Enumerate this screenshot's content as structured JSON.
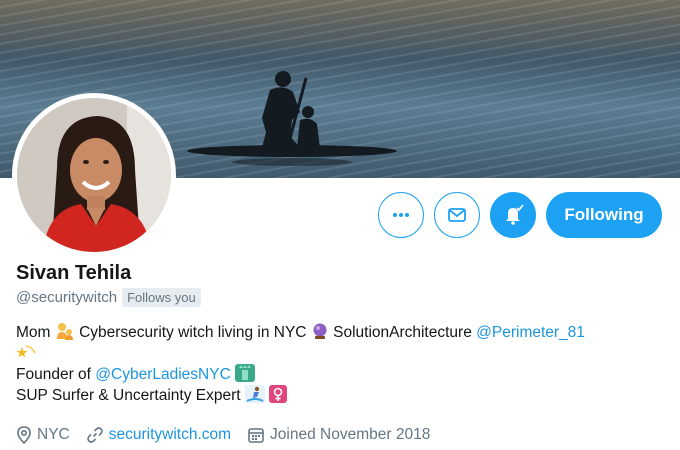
{
  "profile": {
    "name": "Sivan Tehila",
    "handle": "@securitywitch",
    "follows_you": "Follows you"
  },
  "actions": {
    "more_icon": "more-icon",
    "message_icon": "envelope-icon",
    "notify_icon": "bell-check-icon",
    "follow_label": "Following"
  },
  "bio": {
    "line1_a": "Mom",
    "line1_b": "Cybersecurity witch living in NYC",
    "line1_c": "SolutionArchitecture",
    "line1_mention": "@Perimeter_81",
    "line3_a": "Founder of",
    "line3_mention": "@CyberLadiesNYC",
    "line4": "SUP Surfer & Uncertainty Expert"
  },
  "meta": {
    "location": "NYC",
    "website": "securitywitch.com",
    "joined": "Joined November 2018"
  },
  "colors": {
    "accent": "#1da1f2",
    "link": "#1b95e0",
    "muted": "#657786"
  }
}
